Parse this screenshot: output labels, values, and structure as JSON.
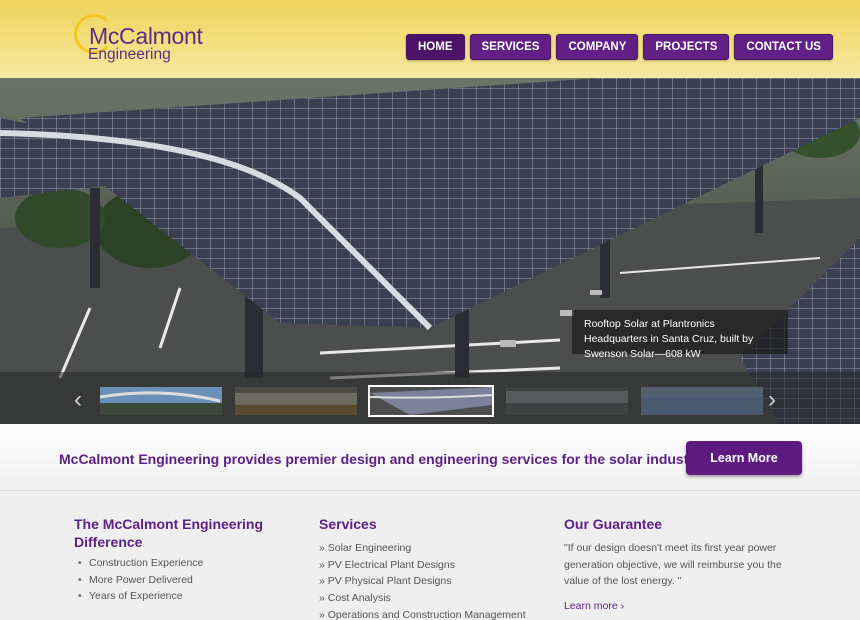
{
  "logo": {
    "line1": "McCalmont",
    "line2": "Engineering"
  },
  "nav": {
    "items": [
      {
        "label": "HOME",
        "active": true
      },
      {
        "label": "SERVICES"
      },
      {
        "label": "COMPANY"
      },
      {
        "label": "PROJECTS"
      },
      {
        "label": "CONTACT US"
      }
    ]
  },
  "hero": {
    "caption": "Rooftop Solar at Plantronics Headquarters in Santa Cruz, built by Swenson Solar—608 kW",
    "prev_icon": "chevron-left-icon",
    "next_icon": "chevron-right-icon",
    "thumbnails_count": 6
  },
  "banner": {
    "text": "McCalmont Engineering provides premier design and engineering services for the solar industry.",
    "button_label": "Learn More"
  },
  "difference": {
    "title": "The McCalmont Engineering Difference",
    "items": [
      "Construction Experience",
      "More Power Delivered",
      "Years of Experience"
    ]
  },
  "services": {
    "title": "Services",
    "items": [
      "» Solar Engineering",
      "» PV Electrical Plant Designs",
      "» PV Physical Plant Designs",
      "» Cost Analysis",
      "» Operations and Construction Management"
    ]
  },
  "guarantee": {
    "title": "Our Guarantee",
    "text": "\"If our design doesn't meet its first year power generation objective, we will reimburse you the value of the lost energy. \"",
    "link": "Learn more ›"
  },
  "colors": {
    "brand_purple": "#621f85",
    "header_yellow": "#efd35c"
  }
}
